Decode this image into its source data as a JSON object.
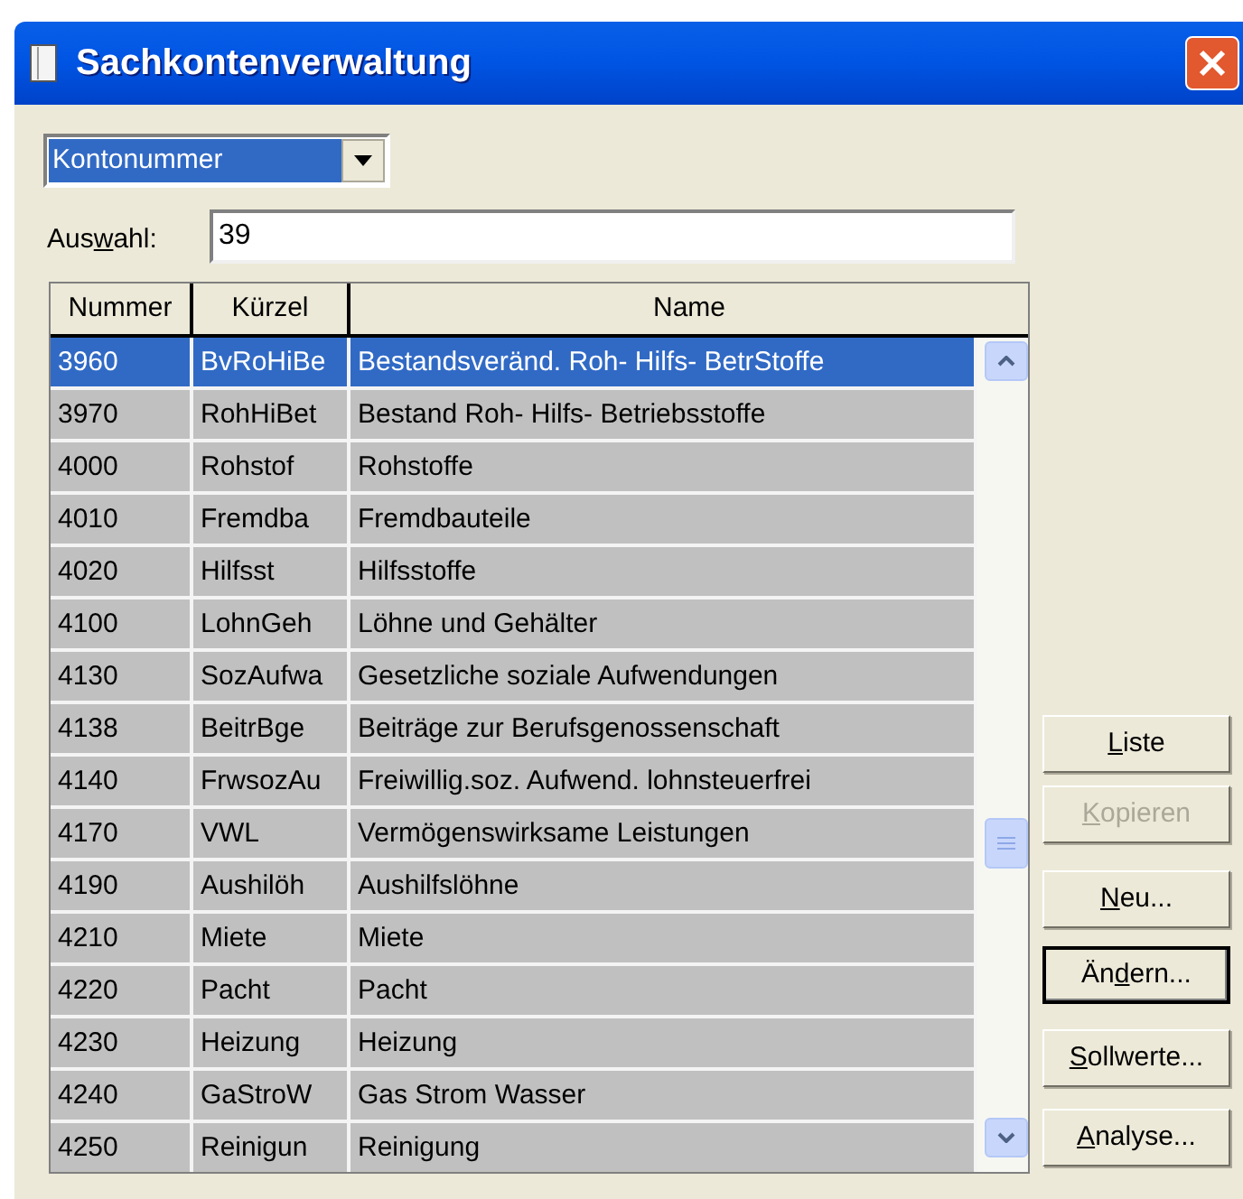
{
  "window": {
    "title": "Sachkontenverwaltung"
  },
  "sort_dropdown": {
    "value": "Kontonummer"
  },
  "filter": {
    "label_before": "Aus",
    "access_key": "w",
    "label_after": "ahl:",
    "value": "39"
  },
  "table": {
    "columns": [
      "Nummer",
      "Kürzel",
      "Name"
    ],
    "rows": [
      {
        "cells": [
          "3960",
          "BvRoHiBe",
          "Bestandsveränd. Roh- Hilfs- BetrStoffe"
        ],
        "selected": true
      },
      {
        "cells": [
          "3970",
          "RohHiBet",
          "Bestand Roh- Hilfs- Betriebsstoffe"
        ],
        "selected": false
      },
      {
        "cells": [
          "4000",
          "Rohstof",
          "Rohstoffe"
        ],
        "selected": false
      },
      {
        "cells": [
          "4010",
          "Fremdba",
          "Fremdbauteile"
        ],
        "selected": false
      },
      {
        "cells": [
          "4020",
          "Hilfsst",
          "Hilfsstoffe"
        ],
        "selected": false
      },
      {
        "cells": [
          "4100",
          "LohnGeh",
          "Löhne und Gehälter"
        ],
        "selected": false
      },
      {
        "cells": [
          "4130",
          "SozAufwa",
          "Gesetzliche soziale Aufwendungen"
        ],
        "selected": false
      },
      {
        "cells": [
          "4138",
          "BeitrBge",
          "Beiträge zur Berufsgenossenschaft"
        ],
        "selected": false
      },
      {
        "cells": [
          "4140",
          "FrwsozAu",
          "Freiwillig.soz. Aufwend. lohnsteuerfrei"
        ],
        "selected": false
      },
      {
        "cells": [
          "4170",
          "VWL",
          "Vermögenswirksame Leistungen"
        ],
        "selected": false
      },
      {
        "cells": [
          "4190",
          "Aushilöh",
          "Aushilfslöhne"
        ],
        "selected": false
      },
      {
        "cells": [
          "4210",
          "Miete",
          "Miete"
        ],
        "selected": false
      },
      {
        "cells": [
          "4220",
          "Pacht",
          "Pacht"
        ],
        "selected": false
      },
      {
        "cells": [
          "4230",
          "Heizung",
          "Heizung"
        ],
        "selected": false
      },
      {
        "cells": [
          "4240",
          "GaStroW",
          "Gas Strom Wasser"
        ],
        "selected": false
      },
      {
        "cells": [
          "4250",
          "Reinigun",
          "Reinigung"
        ],
        "selected": false
      }
    ]
  },
  "buttons": [
    {
      "access_key": "L",
      "label_after": "iste",
      "disabled": false,
      "default": false
    },
    {
      "access_key": "K",
      "label_after": "opieren",
      "disabled": true,
      "default": false
    },
    {
      "access_key": "N",
      "label_after": "eu...",
      "disabled": false,
      "default": false
    },
    {
      "label_before": "Än",
      "access_key": "d",
      "label_after": "ern...",
      "disabled": false,
      "default": true
    },
    {
      "access_key": "S",
      "label_after": "ollwerte...",
      "disabled": false,
      "default": false
    },
    {
      "access_key": "A",
      "label_after": "nalyse...",
      "disabled": false,
      "default": false
    }
  ]
}
